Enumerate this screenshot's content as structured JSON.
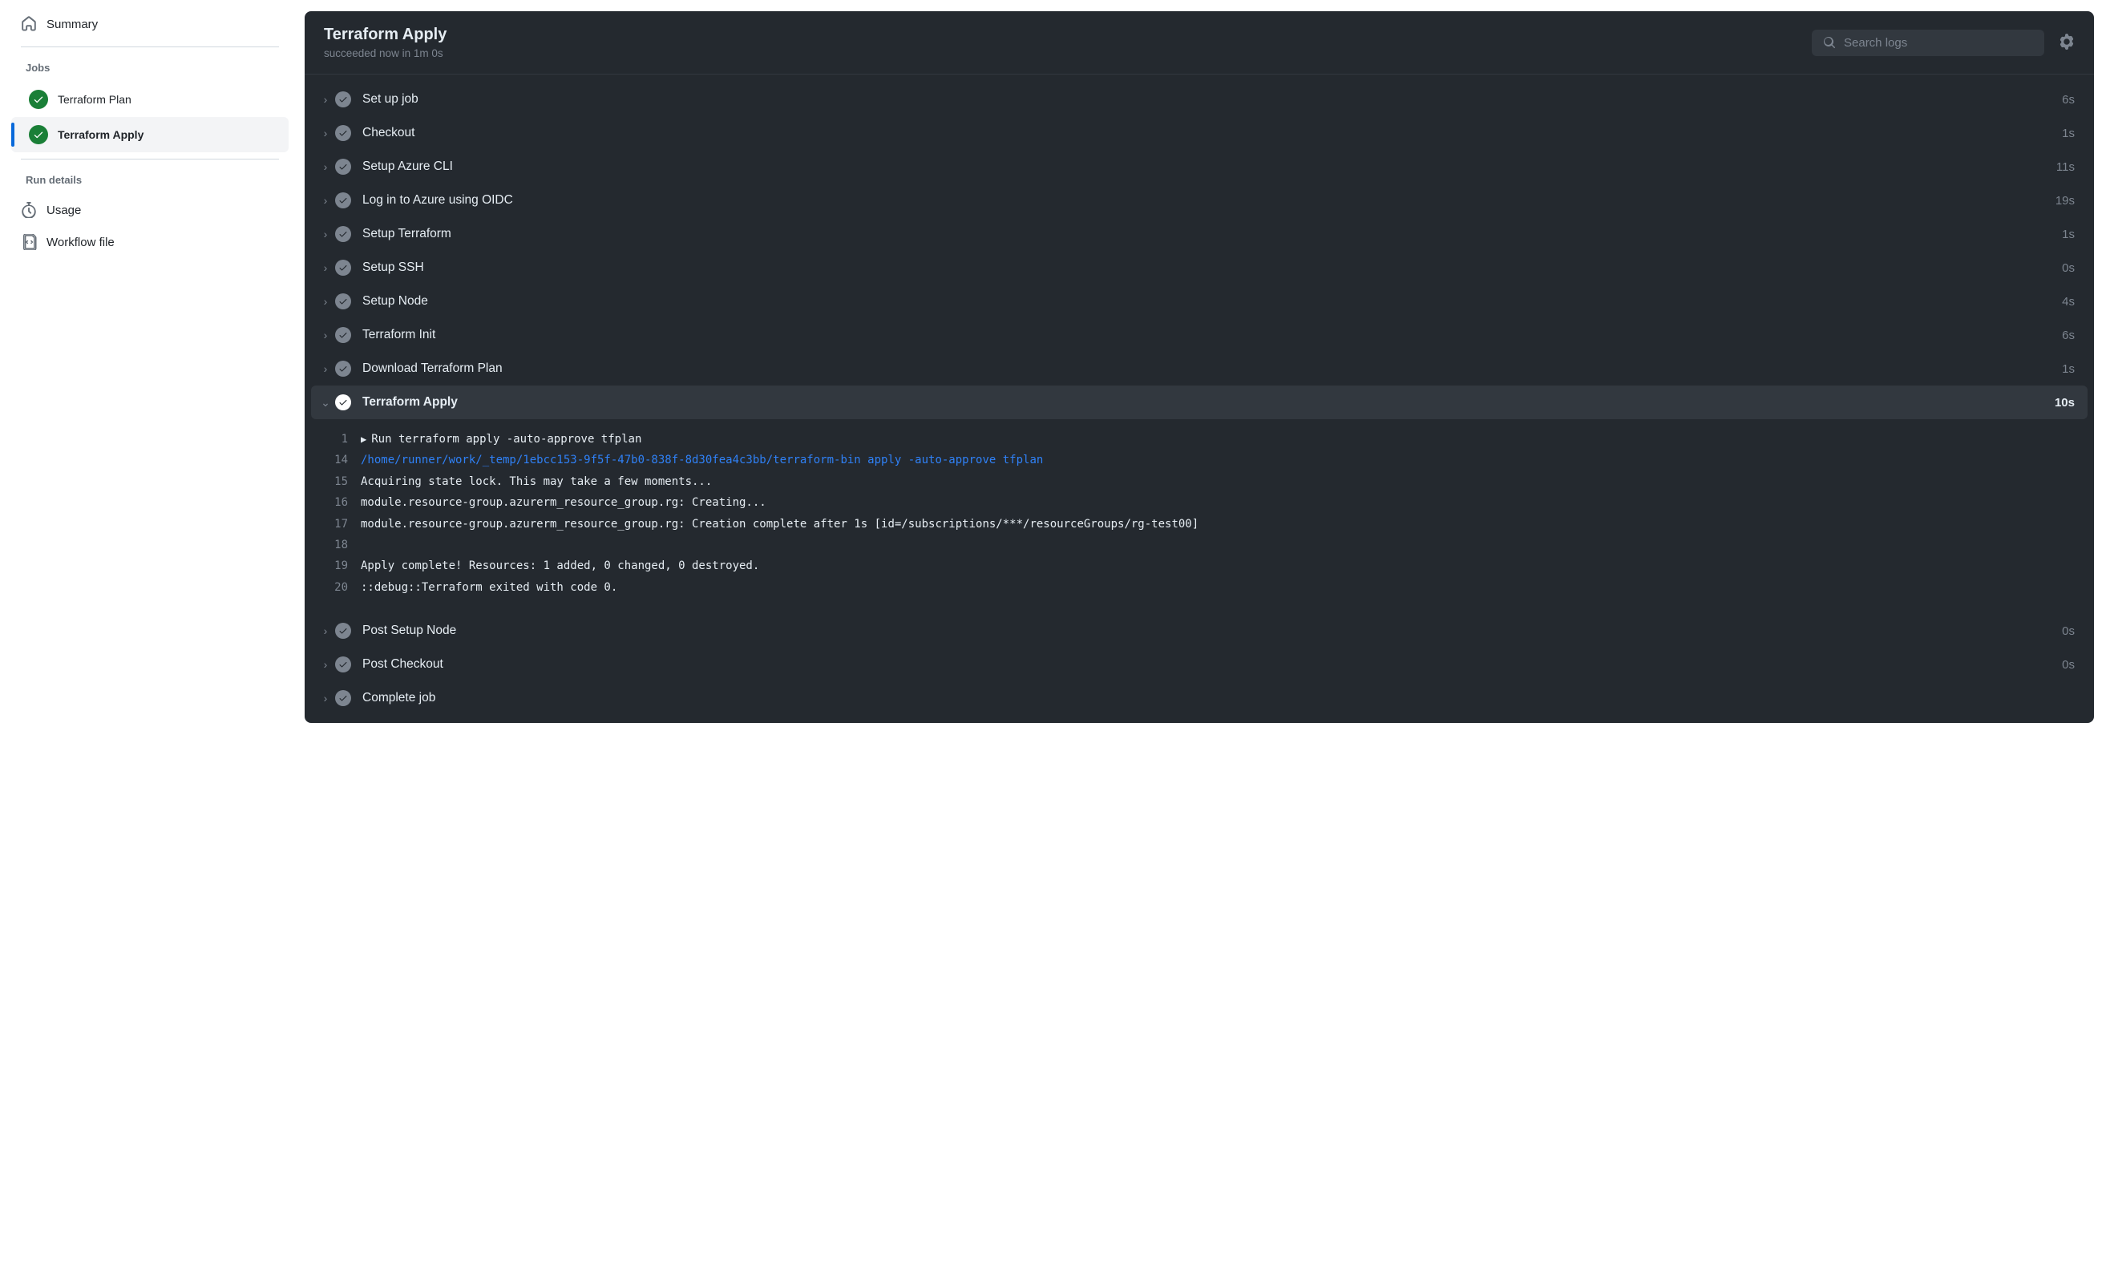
{
  "sidebar": {
    "summary_label": "Summary",
    "jobs_header": "Jobs",
    "jobs": [
      {
        "label": "Terraform Plan"
      },
      {
        "label": "Terraform Apply"
      }
    ],
    "details_header": "Run details",
    "usage_label": "Usage",
    "workflow_file_label": "Workflow file"
  },
  "header": {
    "title": "Terraform Apply",
    "status": "succeeded now in 1m 0s",
    "search_placeholder": "Search logs"
  },
  "steps": [
    {
      "name": "Set up job",
      "duration": "6s"
    },
    {
      "name": "Checkout",
      "duration": "1s"
    },
    {
      "name": "Setup Azure CLI",
      "duration": "11s"
    },
    {
      "name": "Log in to Azure using OIDC",
      "duration": "19s"
    },
    {
      "name": "Setup Terraform",
      "duration": "1s"
    },
    {
      "name": "Setup SSH",
      "duration": "0s"
    },
    {
      "name": "Setup Node",
      "duration": "4s"
    },
    {
      "name": "Terraform Init",
      "duration": "6s"
    },
    {
      "name": "Download Terraform Plan",
      "duration": "1s"
    }
  ],
  "expanded_step": {
    "name": "Terraform Apply",
    "duration": "10s"
  },
  "logs": [
    {
      "n": "1",
      "text": "Run terraform apply -auto-approve tfplan",
      "disc": true
    },
    {
      "n": "14",
      "text": "/home/runner/work/_temp/1ebcc153-9f5f-47b0-838f-8d30fea4c3bb/terraform-bin apply -auto-approve tfplan",
      "link": true
    },
    {
      "n": "15",
      "text": "Acquiring state lock. This may take a few moments..."
    },
    {
      "n": "16",
      "text": "module.resource-group.azurerm_resource_group.rg: Creating..."
    },
    {
      "n": "17",
      "text": "module.resource-group.azurerm_resource_group.rg: Creation complete after 1s [id=/subscriptions/***/resourceGroups/rg-test00]"
    },
    {
      "n": "18",
      "text": ""
    },
    {
      "n": "19",
      "text": "Apply complete! Resources: 1 added, 0 changed, 0 destroyed."
    },
    {
      "n": "20",
      "text": "::debug::Terraform exited with code 0."
    }
  ],
  "post_steps": [
    {
      "name": "Post Setup Node",
      "duration": "0s"
    },
    {
      "name": "Post Checkout",
      "duration": "0s"
    },
    {
      "name": "Complete job",
      "duration": ""
    }
  ]
}
